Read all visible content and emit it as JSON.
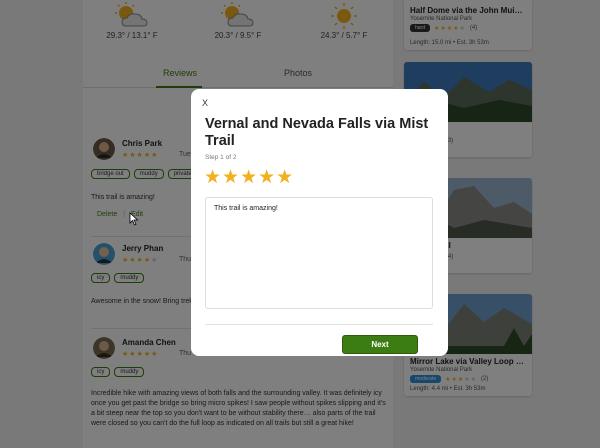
{
  "weather": [
    {
      "icon": "partly-cloudy-icon",
      "temp": "29.3° / 13.1° F"
    },
    {
      "icon": "partly-cloudy-icon",
      "temp": "20.3° / 9.5° F"
    },
    {
      "icon": "sun-icon",
      "temp": "24.3° / 5.7° F"
    }
  ],
  "tabs": [
    {
      "label": "Reviews",
      "active": true
    },
    {
      "label": "Photos",
      "active": false
    }
  ],
  "reviews": [
    {
      "name": "Chris Park",
      "rating": 5,
      "date": "Tue Ja",
      "tags": [
        "bridge out",
        "muddy",
        "private"
      ],
      "text": "This trail is amazing!",
      "actions": [
        "Delete",
        "Edit"
      ]
    },
    {
      "name": "Jerry Phan",
      "rating": 4,
      "date": "Thu Ju",
      "tags": [
        "icy",
        "muddy"
      ],
      "text": "Awesome in the snow! Bring trekk"
    },
    {
      "name": "Amanda Chen",
      "rating": 5,
      "date": "Thu Oc",
      "tags": [
        "icy",
        "muddy"
      ],
      "text": "Incredible hike with amazing views of both falls and the surrounding valley. It was definitely icy once you get past the bridge so bring micro spikes! I saw people without spikes slipping and it's a bit steep near the top so you don't want to be without stability there… also parts of the trail were closed so you can't do the full loop as indicated on all trails but still a great hike!"
    }
  ],
  "trail_cards": [
    {
      "title": "Half Dome via the John Mui…",
      "park": "Yosemite National Park",
      "difficulty": "hard",
      "difficulty_color": "#333333",
      "rating": 4,
      "count": "(4)",
      "meta": "Length: 15.0 mi • Est. 3h 53m"
    },
    {
      "title": "point Trail",
      "park": "",
      "difficulty": "",
      "difficulty_color": "",
      "rating": 4,
      "count": "(3)",
      "meta": "• Est. 3h 53m"
    },
    {
      "title": "Dome Trail",
      "park": "",
      "difficulty": "",
      "difficulty_color": "",
      "rating": 4,
      "count": "(4)",
      "meta": "• Est. 3h 53m"
    },
    {
      "title": "Mirror Lake via Valley Loop …",
      "park": "Yosemite National Park",
      "difficulty": "moderate",
      "difficulty_color": "#2f8fd8",
      "rating": 3,
      "count": "(2)",
      "meta": "Length: 4.4 mi • Est. 3h 53m"
    }
  ],
  "modal": {
    "close": "X",
    "title": "Vernal and Nevada Falls via Mist Trail",
    "step": "Step 1 of 2",
    "stars": "★★★★★",
    "rating": 5,
    "review_text": "This trail is amazing!",
    "next_label": "Next"
  },
  "colors": {
    "accent": "#3b7d12",
    "star": "#f2b01e"
  }
}
